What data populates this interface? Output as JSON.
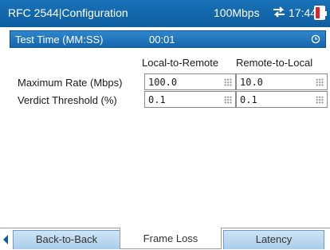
{
  "header": {
    "title": "RFC 2544|Configuration",
    "link_rate": "100Mbps",
    "time": "17:44",
    "icons": [
      "link-arrows-icon",
      "battery-low-icon"
    ]
  },
  "test_time": {
    "label": "Test Time (MM:SS)",
    "value": "00:01",
    "icon": "timer-icon"
  },
  "columns": {
    "local_to_remote": "Local-to-Remote",
    "remote_to_local": "Remote-to-Local"
  },
  "rows": [
    {
      "label": "Maximum Rate (Mbps)",
      "local": "100.0",
      "remote": "10.0"
    },
    {
      "label": "Verdict Threshold (%)",
      "local": "0.1",
      "remote": "0.1"
    }
  ],
  "tabs": [
    {
      "label": "Back-to-Back",
      "active": false
    },
    {
      "label": "Frame Loss",
      "active": true
    },
    {
      "label": "Latency",
      "active": false
    }
  ],
  "colors": {
    "header_blue": "#0d5d9f",
    "selected_row_blue": "#1667ad",
    "battery_low": "#d8262c"
  }
}
